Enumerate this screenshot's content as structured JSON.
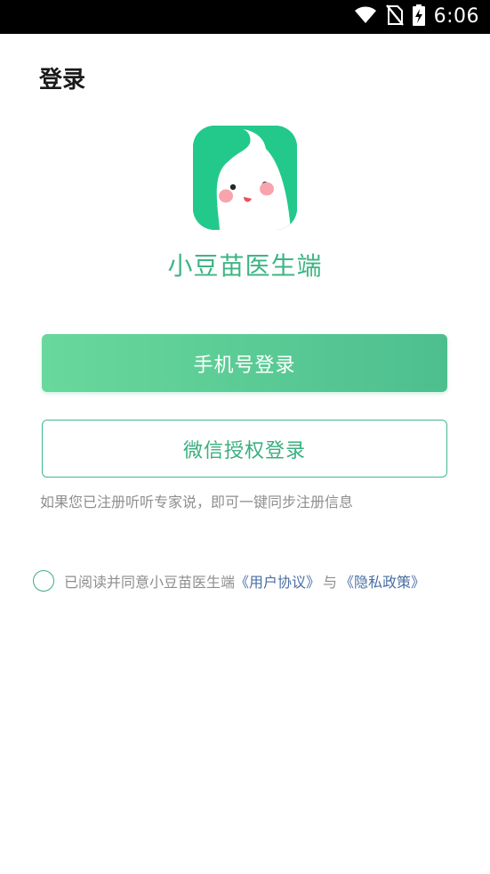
{
  "status_bar": {
    "time": "6:06",
    "icons": [
      "wifi-icon",
      "no-sim-icon",
      "battery-charging-icon"
    ]
  },
  "page": {
    "title": "登录"
  },
  "app": {
    "name": "小豆苗医生端",
    "logo_icon": "mascot-logo-icon",
    "brand_color": "#23c98b"
  },
  "buttons": {
    "phone_login": "手机号登录",
    "wechat_login": "微信授权登录"
  },
  "hint": "如果您已注册听听专家说，即可一键同步注册信息",
  "agreement": {
    "prefix": "已阅读并同意小豆苗医生端",
    "user_agreement": "《用户协议》",
    "connector": "与",
    "privacy_policy": "《隐私政策》",
    "checked": false
  },
  "colors": {
    "accent": "#3aae80",
    "link": "#4a6fa5",
    "hint": "#8e8e8e"
  }
}
